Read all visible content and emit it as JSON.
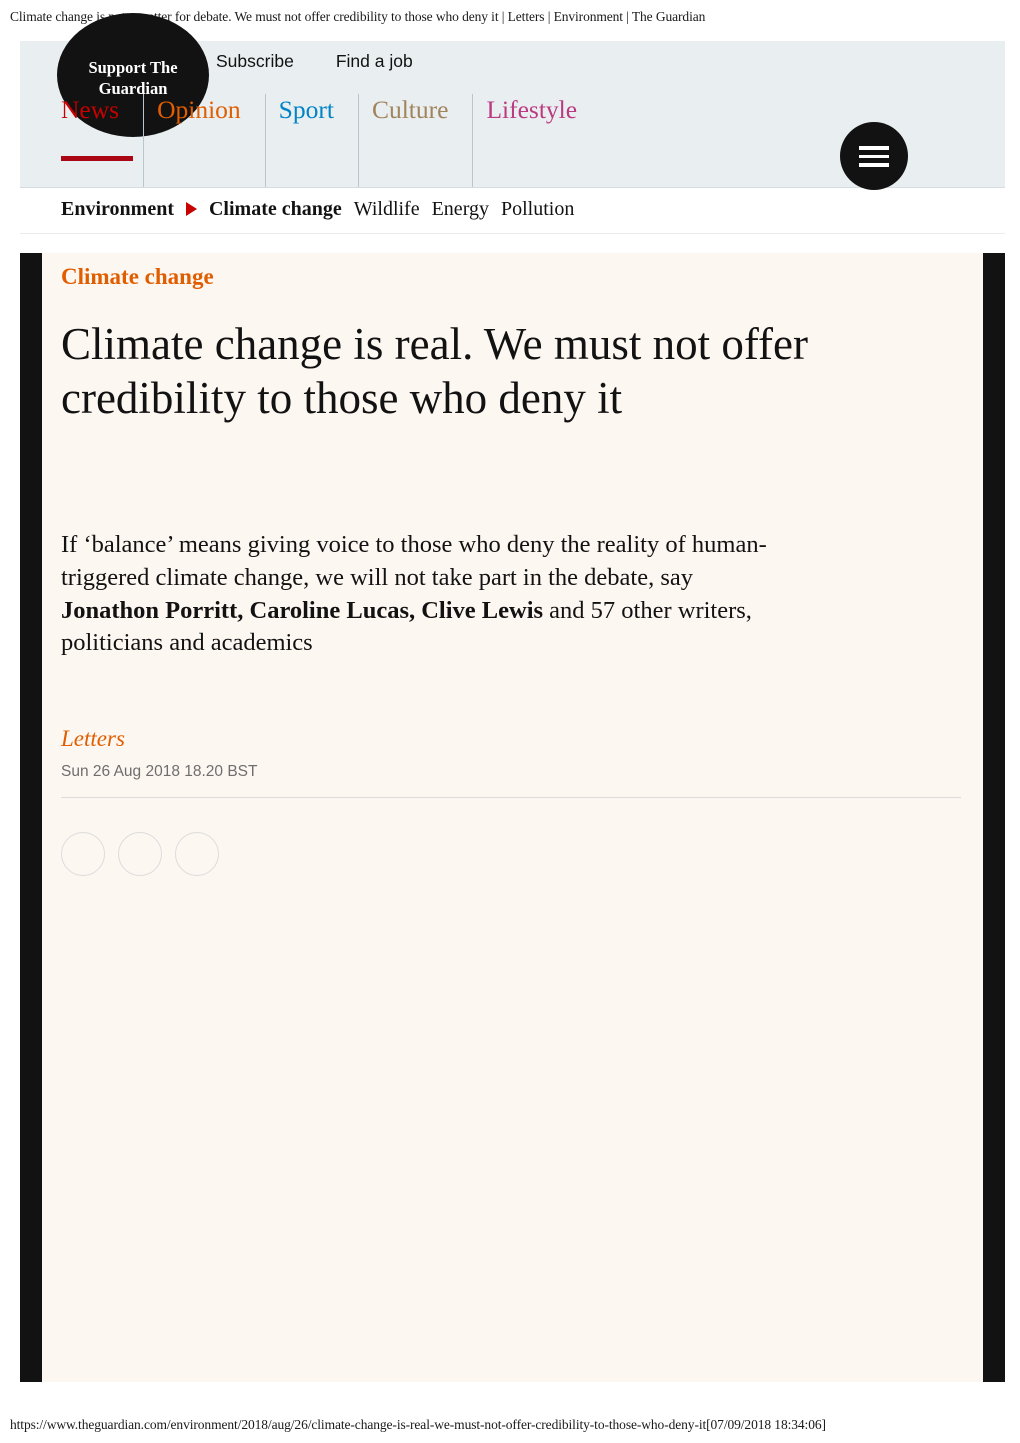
{
  "print": {
    "header_title": "Climate change is not a matter for debate. We must not offer credibility to those who deny it | Letters | Environment | The Guardian",
    "footer_url": "https://www.theguardian.com/environment/2018/aug/26/climate-change-is-real-we-must-not-offer-credibility-to-those-who-deny-it[07/09/2018 18:34:06]"
  },
  "header": {
    "support_label": "Support The Guardian",
    "utility": [
      {
        "label": "Subscribe"
      },
      {
        "label": "Find a job"
      }
    ],
    "pillars": [
      {
        "label": "News",
        "color": "#c70000",
        "active": true
      },
      {
        "label": "Opinion",
        "color": "#e05e00",
        "active": false
      },
      {
        "label": "Sport",
        "color": "#0084c6",
        "active": false
      },
      {
        "label": "Culture",
        "color": "#a1845c",
        "active": false
      },
      {
        "label": "Lifestyle",
        "color": "#bb3b80",
        "active": false
      }
    ],
    "menu_icon": "hamburger-icon"
  },
  "subnav": {
    "section": "Environment",
    "separator_icon": "triangle-right-icon",
    "current": "Climate change",
    "items": [
      {
        "label": "Wildlife"
      },
      {
        "label": "Energy"
      },
      {
        "label": "Pollution"
      }
    ]
  },
  "article": {
    "kicker": "Climate change",
    "headline": "Climate change is real. We must not offer credibility to those who deny it",
    "standfirst_part1": "If ‘balance’ means giving voice to those who deny the reality of human-triggered climate change, we will not take part in the debate, say ",
    "standfirst_authors": "Jonathon Porritt, Caroline Lucas, Clive Lewis",
    "standfirst_part2": " and 57 other writers, politicians and academics",
    "byline": "Letters",
    "pubdate": "Sun 26 Aug 2018 18.20 BST",
    "share_buttons": [
      {
        "icon": "facebook-share-icon"
      },
      {
        "icon": "twitter-share-icon"
      },
      {
        "icon": "email-share-icon"
      }
    ]
  },
  "colors": {
    "brand_orange": "#e05e00",
    "news_red": "#c70000",
    "header_band": "#e9eef1",
    "article_bg": "#fdf7f2",
    "edge_bar": "#121212"
  }
}
